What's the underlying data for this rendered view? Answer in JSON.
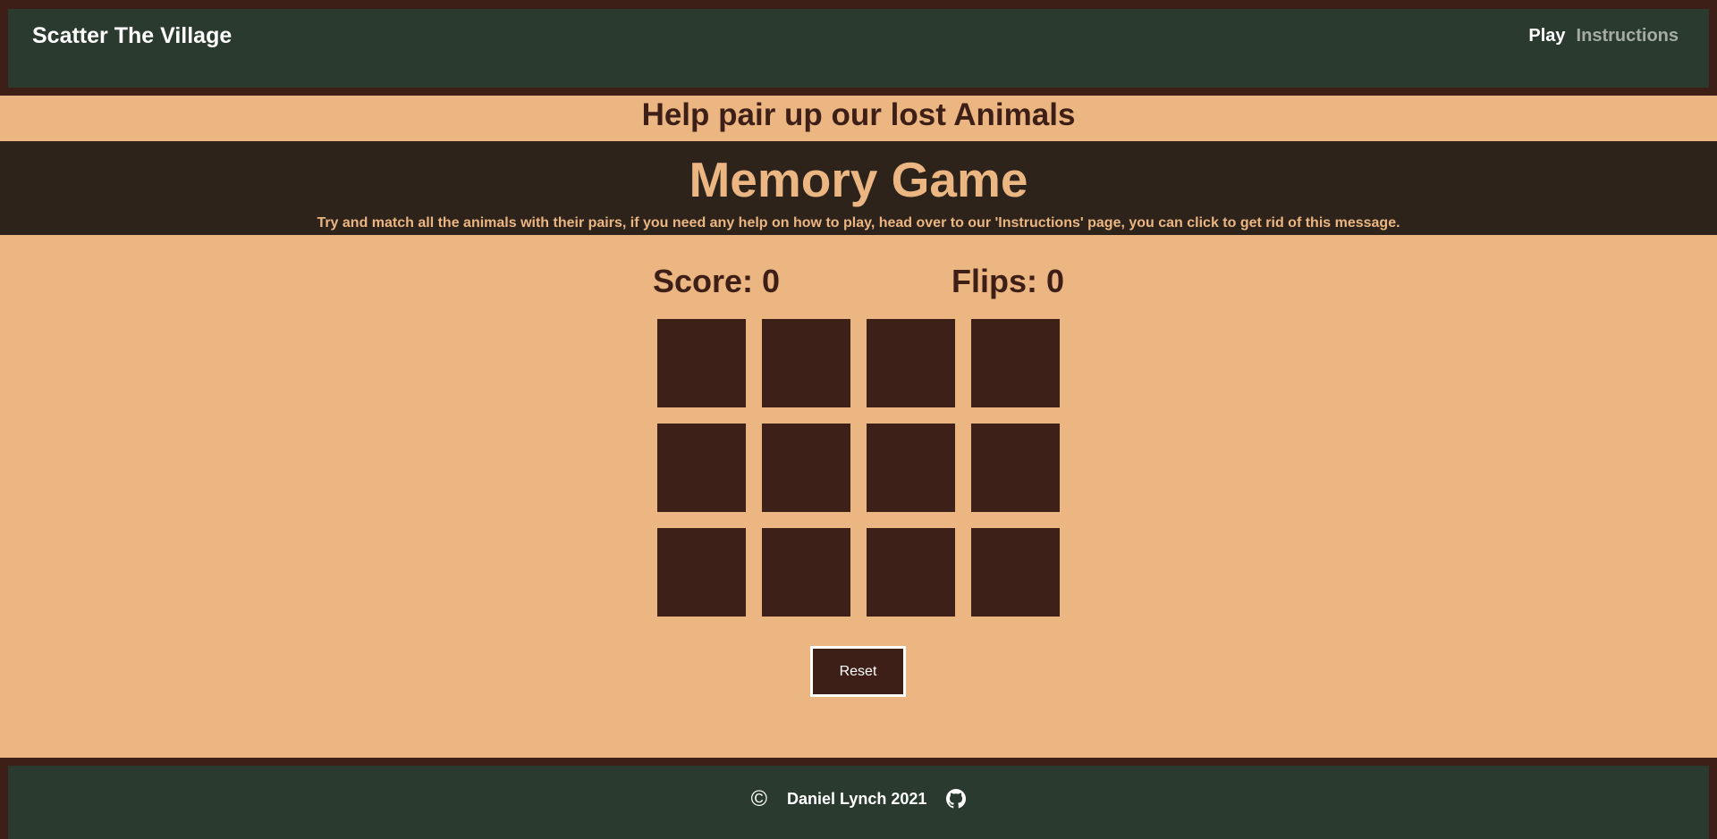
{
  "navbar": {
    "brand": "Scatter The Village",
    "links": [
      {
        "label": "Play",
        "active": true
      },
      {
        "label": "Instructions",
        "active": false
      }
    ]
  },
  "subheading": "Help pair up our lost Animals",
  "banner": {
    "title": "Memory Game",
    "message": "Try and match all the animals with their pairs, if you need any help on how to play, head over to our 'Instructions' page, you can click to get rid of this message."
  },
  "stats": {
    "score_label": "Score: 0",
    "flips_label": "Flips: 0"
  },
  "board": {
    "rows": 3,
    "columns": 4,
    "card_count": 12
  },
  "reset_label": "Reset",
  "footer": {
    "copyright_icon": "copyright-icon",
    "author": "Daniel Lynch 2021",
    "github_icon": "github-icon"
  },
  "colors": {
    "page_background": "#ebb682",
    "navbar_border": "#3d1f18",
    "navbar_fill": "#2b3a2e",
    "banner_background": "#2d231b",
    "card_back": "#3d2119",
    "text_dark": "#3d1f18",
    "accent_text": "#ebb682"
  }
}
